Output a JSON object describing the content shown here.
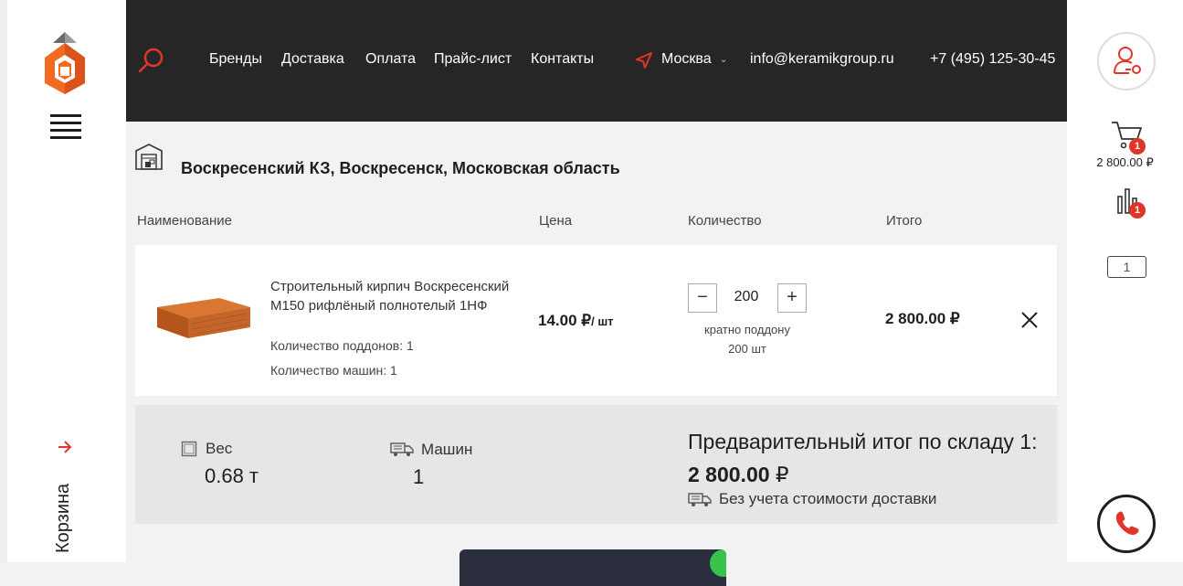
{
  "nav": {
    "items": [
      "Бренды",
      "Доставка",
      "Оплата",
      "Прайс-лист",
      "Контакты"
    ],
    "city": "Москва",
    "email": "info@keramikgroup.ru",
    "phone": "+7 (495) 125-30-45"
  },
  "sidebar": {
    "cart_label": "Корзина"
  },
  "right_panel": {
    "cart_badge": "1",
    "cart_total": "2 800.00 ₽",
    "compare_badge": "1",
    "page_value": "1"
  },
  "warehouse": {
    "title": "Воскресенский КЗ, Воскресенск, Московская область"
  },
  "table": {
    "headers": [
      "Наименование",
      "Цена",
      "Количество",
      "Итого"
    ]
  },
  "item": {
    "name": "Строительный кирпич Воскресенский М150 рифлёный полнотелый 1НФ",
    "pallets": "Количество поддонов: 1",
    "trucks": "Количество машин: 1",
    "price": "14.00 ₽",
    "price_unit": "/ шт",
    "qty_minus": "−",
    "qty": "200",
    "qty_plus": "+",
    "qty_note_1": "кратно поддону",
    "qty_note_2": "200 шт",
    "total": "2 800.00 ₽"
  },
  "summary": {
    "weight_label": "Вес",
    "weight_value": "0.68 т",
    "trucks_label": "Машин",
    "trucks_value": "1",
    "subtotal_prefix": "Предварительный итог по складу 1:",
    "subtotal_value": "2 800.00",
    "subtotal_currency": "₽",
    "delivery_note": "Без учета стоимости доставки"
  },
  "colors": {
    "accent": "#e0362a",
    "header_bg": "#262626",
    "logo_orange": "#f26b21",
    "summary_bg": "#e6e6e6"
  }
}
